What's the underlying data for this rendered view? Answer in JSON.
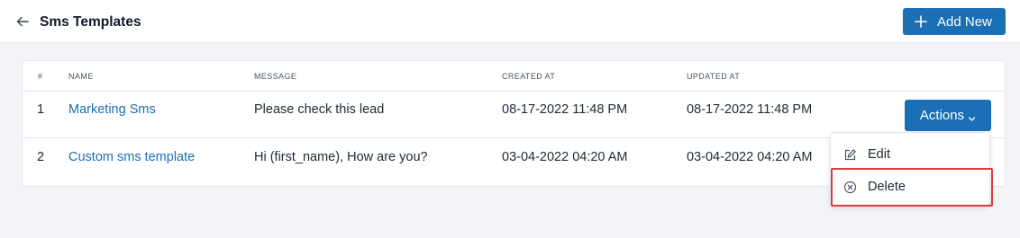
{
  "header": {
    "title": "Sms Templates",
    "add_new_label": "Add New"
  },
  "table": {
    "columns": [
      "#",
      "NAME",
      "MESSAGE",
      "CREATED AT",
      "UPDATED AT"
    ],
    "rows": [
      {
        "index": "1",
        "name": "Marketing Sms",
        "message": "Please check this lead",
        "created_at": "08-17-2022 11:48 PM",
        "updated_at": "08-17-2022 11:48 PM"
      },
      {
        "index": "2",
        "name": "Custom sms template",
        "message": "Hi (first_name), How are you?",
        "created_at": "03-04-2022 04:20 AM",
        "updated_at": "03-04-2022 04:20 AM"
      }
    ]
  },
  "actions": {
    "button_label": "Actions",
    "menu": {
      "edit_label": "Edit",
      "delete_label": "Delete"
    }
  },
  "colors": {
    "accent": "#1a6fb5",
    "highlight": "#e0393e",
    "background": "#f3f4f8"
  },
  "icons": [
    "back-arrow-icon",
    "plus-icon",
    "chevron-down-icon",
    "edit-icon",
    "delete-icon"
  ]
}
